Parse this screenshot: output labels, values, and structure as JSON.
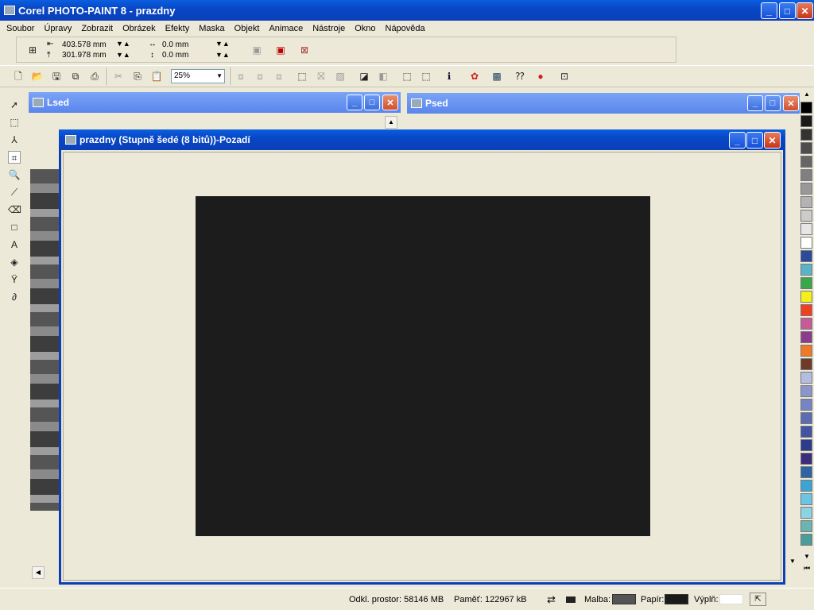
{
  "app": {
    "title": "Corel PHOTO-PAINT 8 - prazdny"
  },
  "window_buttons": {
    "minimize": "_",
    "maximize": "□",
    "close": "✕"
  },
  "menu": [
    "Soubor",
    "Úpravy",
    "Zobrazit",
    "Obrázek",
    "Efekty",
    "Maska",
    "Objekt",
    "Animace",
    "Nástroje",
    "Okno",
    "Nápověda"
  ],
  "property_bar": {
    "width_value": "403.578 mm",
    "height_value": "301.978 mm",
    "x_offset": "0.0 mm",
    "y_offset": "0.0 mm"
  },
  "standard_bar": {
    "zoom": "25%"
  },
  "docs": {
    "left": {
      "title": "Lsed"
    },
    "right": {
      "title": "Psed"
    },
    "main": {
      "title": "prazdny  (Stupně šedé (8 bitů))-Pozadí"
    }
  },
  "canvas": {
    "color": "#1c1c1c",
    "background": "#ece9d8"
  },
  "palette": [
    "#000000",
    "#1a1a1a",
    "#333333",
    "#4d4d4d",
    "#666666",
    "#808080",
    "#999999",
    "#b3b3b3",
    "#cccccc",
    "#e6e6e6",
    "#ffffff",
    "#2b4a9a",
    "#5ab4c8",
    "#3aa84a",
    "#f4f01c",
    "#f04020",
    "#c85a9a",
    "#8c3c8c",
    "#f07828",
    "#6c3c28",
    "#b4bce0",
    "#8c94cc",
    "#7484c4",
    "#5c6cb4",
    "#4454a4",
    "#2c3c8c",
    "#3c2c7c",
    "#2c64a4",
    "#3ca4d4",
    "#6cc4e4",
    "#8cd4e4",
    "#6cb4b4",
    "#4c9c9c"
  ],
  "status": {
    "disk": "Odkl. prostor: 58146 MB",
    "memory": "Paměť: 122967 kB",
    "paint_label": "Malba:",
    "paint_color": "#555555",
    "paper_label": "Papír:",
    "paper_color": "#1a1a1a",
    "fill_label": "Výplň:",
    "fill_color": "#ffffff"
  }
}
